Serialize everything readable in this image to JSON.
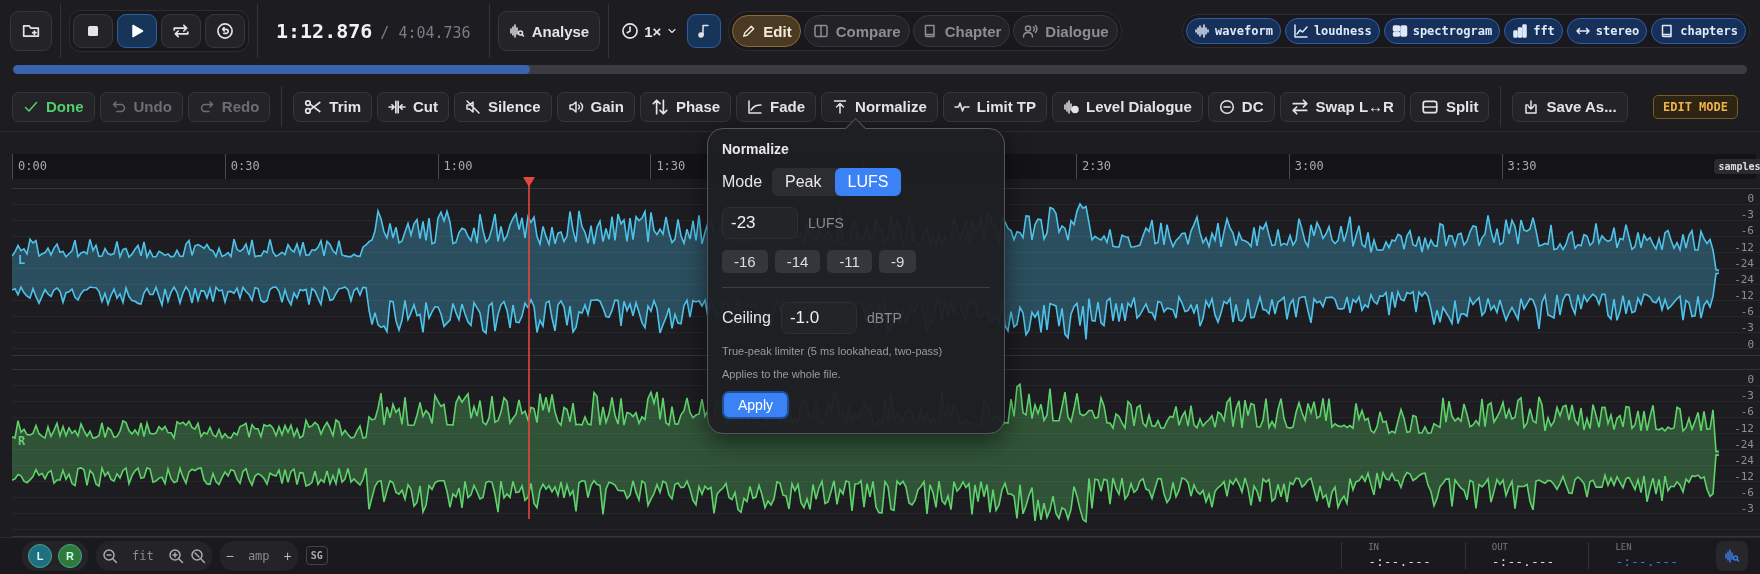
{
  "transport": [
    {
      "kind": "stop",
      "selected": false
    },
    {
      "kind": "play",
      "selected": true
    },
    {
      "kind": "loop",
      "selected": false
    },
    {
      "kind": "revert",
      "selected": false
    }
  ],
  "time": {
    "position": "1:12.876",
    "duration": "/ 4:04.736"
  },
  "analyse_button": "Analyse",
  "speed": "1×",
  "pitch_toggle": {
    "on": true
  },
  "modes": [
    {
      "label": "Edit",
      "kind": "edit",
      "selected": true
    },
    {
      "label": "Compare",
      "kind": "compare",
      "selected": false
    },
    {
      "label": "Chapter",
      "kind": "chapter",
      "selected": false
    },
    {
      "label": "Dialogue",
      "kind": "dialogue",
      "selected": false
    }
  ],
  "views": [
    {
      "label": "waveform",
      "kind": "waveform",
      "on": true
    },
    {
      "label": "loudness",
      "kind": "loudness",
      "on": true
    },
    {
      "label": "spectrogram",
      "kind": "spectrogram",
      "on": true
    },
    {
      "label": "fft",
      "kind": "fft",
      "on": true
    },
    {
      "label": "stereo",
      "kind": "stereo",
      "on": true
    },
    {
      "label": "chapters",
      "kind": "chapters",
      "on": true
    }
  ],
  "progress": {
    "level": 0.298
  },
  "edit_actions": [
    {
      "label": "Done",
      "kind": "done",
      "disabled": false
    },
    {
      "label": "Undo",
      "kind": "undo",
      "disabled": true
    },
    {
      "label": "Redo",
      "kind": "redo",
      "disabled": true
    }
  ],
  "tools": [
    {
      "label": "Trim",
      "kind": "trim"
    },
    {
      "label": "Cut",
      "kind": "cut"
    },
    {
      "label": "Silence",
      "kind": "silence"
    },
    {
      "label": "Gain",
      "kind": "gain"
    },
    {
      "label": "Phase",
      "kind": "phase"
    },
    {
      "label": "Fade",
      "kind": "fade"
    },
    {
      "label": "Normalize",
      "kind": "normalize"
    },
    {
      "label": "Limit TP",
      "kind": "limit"
    },
    {
      "label": "Level Dialogue",
      "kind": "level"
    },
    {
      "label": "DC",
      "kind": "dc"
    },
    {
      "label": "Swap L↔R",
      "kind": "swap"
    },
    {
      "label": "Split",
      "kind": "split"
    }
  ],
  "save_button": "Save As...",
  "mode_badge": "EDIT MODE",
  "ruler": {
    "label_groups": [
      [
        "0:00",
        "0:30",
        "1:00",
        "1:30"
      ],
      [
        "2:30",
        "3:00",
        "3:30"
      ]
    ],
    "unit_badge": "samples"
  },
  "channels": [
    {
      "label": "L",
      "color": "#4ec3ea",
      "scale": [
        "0",
        "-3",
        "-6",
        "-12",
        "-24",
        "-24",
        "-12",
        "-6",
        "-3",
        "0"
      ]
    },
    {
      "label": "R",
      "color": "#5fd36b",
      "scale": [
        "0",
        "-3",
        "-6",
        "-12",
        "-24",
        "-24",
        "-12",
        "-6",
        "-3"
      ]
    }
  ],
  "popover": {
    "title": "Normalize",
    "mode_label": "Mode",
    "modes": [
      {
        "label": "Peak",
        "selected": false
      },
      {
        "label": "LUFS",
        "selected": true
      }
    ],
    "target": {
      "value": "-23",
      "unit": "LUFS"
    },
    "presets": [
      "-16",
      "-14",
      "-11",
      "-9"
    ],
    "ceiling": {
      "label": "Ceiling",
      "value": "-1.0",
      "unit": "dBTP"
    },
    "notes": [
      "True-peak limiter (5 ms lookahead, two-pass)",
      "Applies to the whole file."
    ],
    "apply_button": "Apply"
  },
  "bottom": {
    "channel_toggles": [
      {
        "label": "L",
        "color": "#1f6f80",
        "on": true
      },
      {
        "label": "R",
        "color": "#2f7a3a",
        "on": true
      }
    ],
    "zoom_label": "fit",
    "amp_minus": "−",
    "amp_label": "amp",
    "amp_plus": "+",
    "sg_button": "SG",
    "readouts": [
      {
        "label": "IN",
        "value": "-:--.---",
        "kind": "point"
      },
      {
        "label": "OUT",
        "value": "-:--.---",
        "kind": "point"
      },
      {
        "label": "LEN",
        "value": "-:--.---",
        "kind": "length"
      }
    ]
  }
}
